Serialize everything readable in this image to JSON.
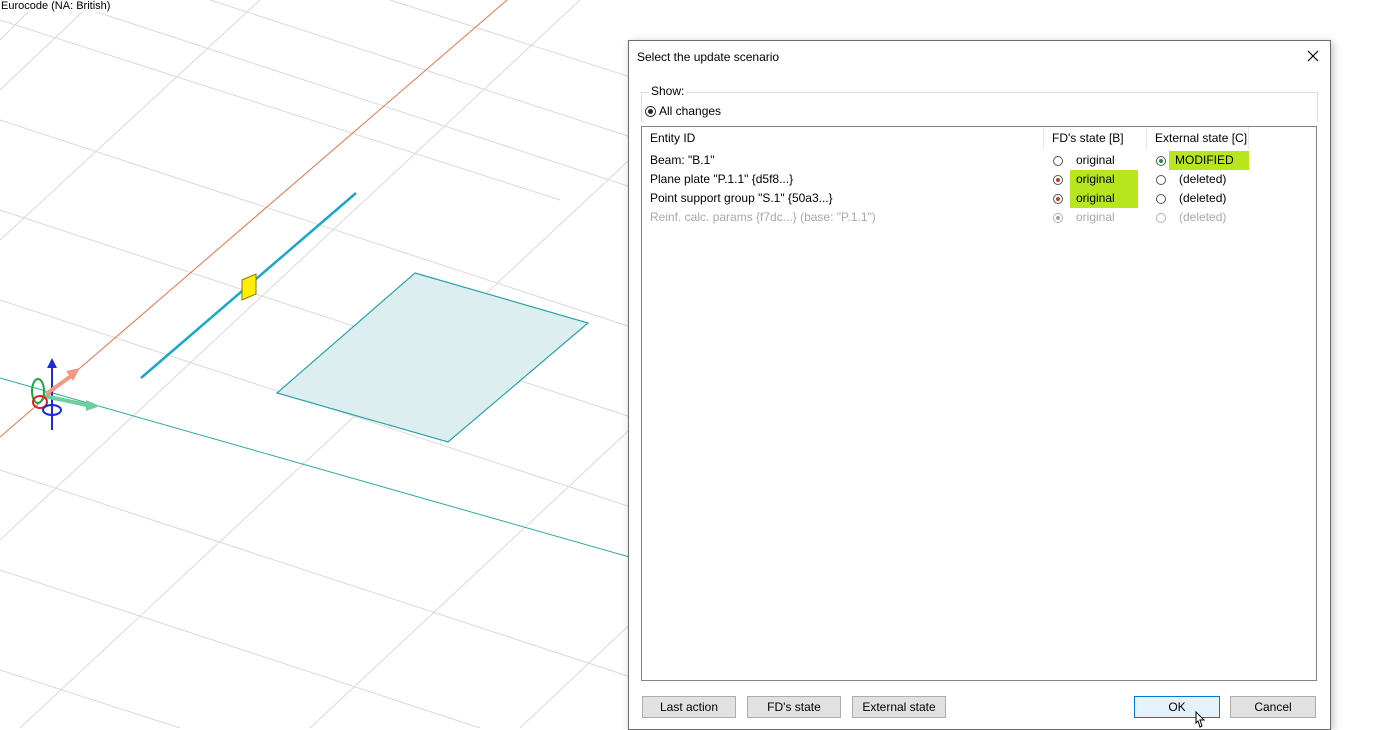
{
  "viewport": {
    "status_label": "Eurocode (NA: British)"
  },
  "dialog": {
    "title": "Select the update scenario",
    "close_icon": "close-icon",
    "show_legend": "Show:",
    "show_option": "All changes",
    "columns": {
      "entity_id": "Entity ID",
      "fd_state": "FD's state [B]",
      "external_state": "External state [C]"
    },
    "rows": [
      {
        "entity": "Beam: \"B.1\"",
        "fd_value": "original",
        "fd_selected": false,
        "fd_highlight": false,
        "ext_value": "MODIFIED",
        "ext_selected": true,
        "ext_highlight": true,
        "enabled": true
      },
      {
        "entity": "Plane plate \"P.1.1\" {d5f8...}",
        "fd_value": "original",
        "fd_selected": true,
        "fd_highlight": true,
        "ext_value": "(deleted)",
        "ext_selected": false,
        "ext_highlight": false,
        "enabled": true
      },
      {
        "entity": "Point support group \"S.1\" {50a3...}",
        "fd_value": "original",
        "fd_selected": true,
        "fd_highlight": true,
        "ext_value": "(deleted)",
        "ext_selected": false,
        "ext_highlight": false,
        "enabled": true
      },
      {
        "entity": "Reinf. calc. params {f7dc...} (base: \"P.1.1\")",
        "fd_value": "original",
        "fd_selected": true,
        "fd_highlight": false,
        "ext_value": "(deleted)",
        "ext_selected": false,
        "ext_highlight": false,
        "enabled": false
      }
    ],
    "buttons": {
      "last_action": "Last action",
      "fd_state": "FD's state",
      "external_state": "External state",
      "ok": "OK",
      "cancel": "Cancel"
    },
    "highlight_color": "#b7e61f"
  }
}
